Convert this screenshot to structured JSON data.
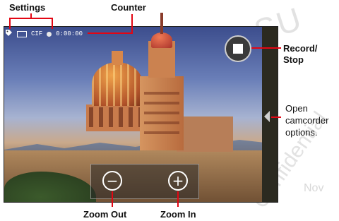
{
  "camcorder": {
    "counter": "0:00:00",
    "resolution": "CIF"
  },
  "callouts": {
    "settings": "Settings",
    "counter": "Counter",
    "record_stop_line1": "Record/",
    "record_stop_line2": "Stop",
    "options_line1": "Open",
    "options_line2": "camcorder",
    "options_line3": "options.",
    "zoom_out": "Zoom Out",
    "zoom_in": "Zoom In"
  },
  "watermark": {
    "sub": "SU",
    "confidential": "Confidential",
    "nov": "Nov"
  },
  "colors": {
    "callout_line": "#e30613",
    "label_text": "#111111"
  },
  "icons": {
    "settings": "tag-icon",
    "storage": "storage-icon",
    "record_status": "record-dot-icon",
    "record_stop": "stop-square-icon",
    "options": "chevron-left-icon",
    "zoom_out": "minus-circle-icon",
    "zoom_in": "plus-circle-icon"
  }
}
